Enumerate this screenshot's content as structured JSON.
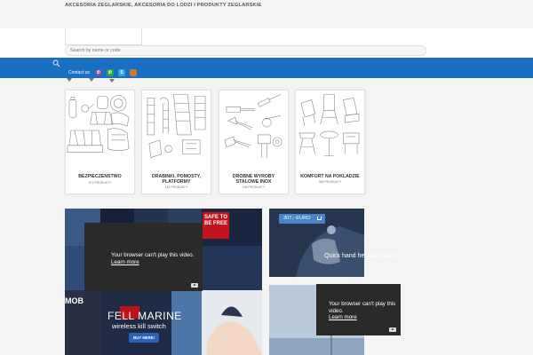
{
  "header": {
    "site_title": "AKCESORIA ZEGLARSKIE, AKCESORIA DO LODZI I PRODUKTY ZEGLARSKIE",
    "search_placeholder": "Search by name or code"
  },
  "nav": {
    "contact_label": "Contact us",
    "social_icons": [
      "viber-icon",
      "whatsapp-icon",
      "skype-icon",
      "flag-icon"
    ],
    "color": "#1a6fc2"
  },
  "categories": [
    {
      "title": "BEZPIECZENSTWO",
      "count": "971 PRODUKTY"
    },
    {
      "title": "DRABINKI, POMOSTY, PLATFORMY",
      "count": "143 PRODUKTY"
    },
    {
      "title": "DROBNE WYROBY STALOWE INOX",
      "count": "138 PRODUKTY"
    },
    {
      "title": "KOMFORT NA POKLADZIE",
      "count": "366 PRODUKTY"
    }
  ],
  "banner_main": {
    "video_message": "Your browser can't play this video.",
    "learn_more": "Learn more",
    "brand": "FELL MARINE",
    "subtitle": "wireless kill switch",
    "buy_button": "BUY HERE!",
    "badge": "SAFE TO BE FREE",
    "mob": "MOB"
  },
  "promo": {
    "price": "307,- EURO",
    "caption": "Quick hand he with chain c"
  },
  "banner_side": {
    "video_message": "Your browser can't play this video.",
    "learn_more": "Learn more"
  }
}
